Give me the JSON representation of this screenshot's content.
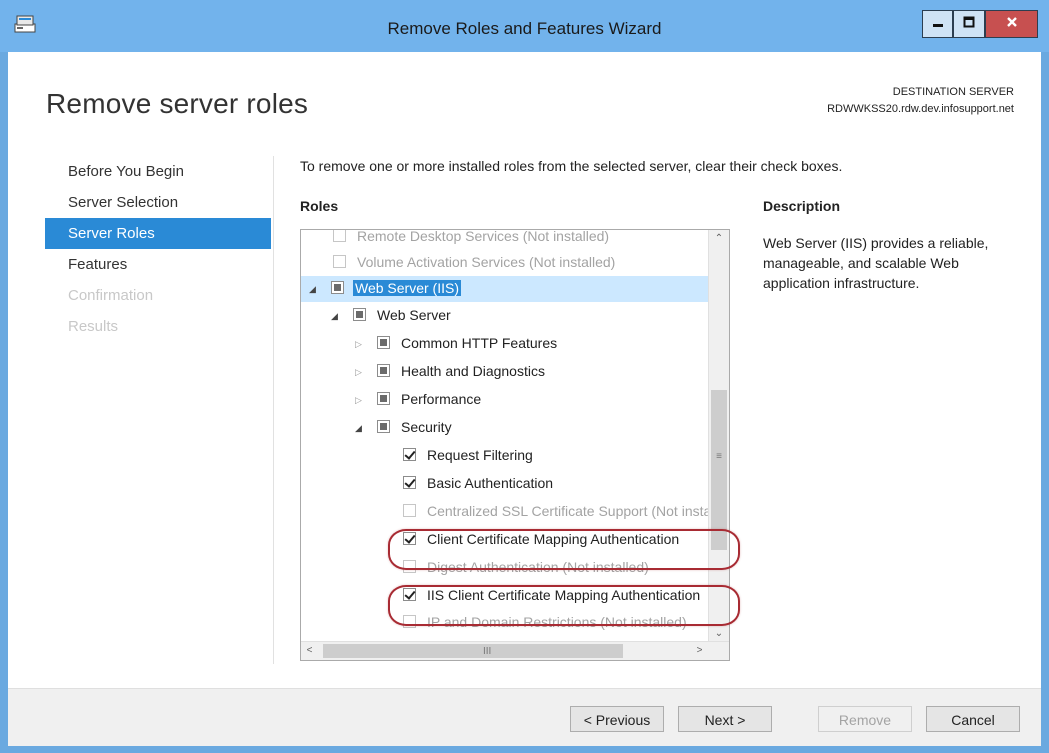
{
  "window": {
    "title": "Remove Roles and Features Wizard"
  },
  "header": {
    "page_title": "Remove server roles",
    "destination_label": "DESTINATION SERVER",
    "destination_server": "RDWWKSS20.rdw.dev.infosupport.net"
  },
  "nav": {
    "items": [
      {
        "label": "Before You Begin",
        "state": "normal"
      },
      {
        "label": "Server Selection",
        "state": "normal"
      },
      {
        "label": "Server Roles",
        "state": "selected"
      },
      {
        "label": "Features",
        "state": "normal"
      },
      {
        "label": "Confirmation",
        "state": "disabled"
      },
      {
        "label": "Results",
        "state": "disabled"
      }
    ]
  },
  "main": {
    "instruction": "To remove one or more installed roles from the selected server, clear their check boxes.",
    "roles_label": "Roles",
    "description_label": "Description",
    "description_text": "Web Server (IIS) provides a reliable, manageable, and scalable Web application infrastructure."
  },
  "tree": {
    "items": [
      {
        "label": "Remote Desktop Services (Not installed)",
        "check": "unchecked",
        "disabled": true
      },
      {
        "label": "Volume Activation Services (Not installed)",
        "check": "unchecked",
        "disabled": true
      },
      {
        "label": "Web Server (IIS)",
        "check": "partial",
        "expanded": true,
        "selected": true
      },
      {
        "label": "Web Server",
        "check": "partial",
        "expanded": true
      },
      {
        "label": "Common HTTP Features",
        "check": "partial",
        "expanded": false
      },
      {
        "label": "Health and Diagnostics",
        "check": "partial",
        "expanded": false
      },
      {
        "label": "Performance",
        "check": "partial",
        "expanded": false
      },
      {
        "label": "Security",
        "check": "partial",
        "expanded": true
      },
      {
        "label": "Request Filtering",
        "check": "checked"
      },
      {
        "label": "Basic Authentication",
        "check": "checked"
      },
      {
        "label": "Centralized SSL Certificate Support (Not installed)",
        "check": "unchecked",
        "disabled": true
      },
      {
        "label": "Client Certificate Mapping Authentication",
        "check": "checked",
        "annotated": true
      },
      {
        "label": "Digest Authentication (Not installed)",
        "check": "unchecked",
        "disabled": true
      },
      {
        "label": "IIS Client Certificate Mapping Authentication",
        "check": "checked",
        "annotated": true
      },
      {
        "label": "IP and Domain Restrictions (Not installed)",
        "check": "unchecked",
        "disabled": true
      }
    ]
  },
  "footer": {
    "previous": "< Previous",
    "next": "Next >",
    "remove": "Remove",
    "cancel": "Cancel"
  },
  "colors": {
    "accent": "#2a8ad6",
    "titlebar": "#72b3ec",
    "annotation": "#a82b33",
    "close": "#c75050"
  }
}
